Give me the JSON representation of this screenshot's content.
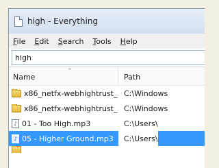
{
  "window": {
    "title": "high - Everything"
  },
  "menu": [
    {
      "label": "File",
      "accel": "F",
      "rest": "ile"
    },
    {
      "label": "Edit",
      "accel": "E",
      "rest": "dit"
    },
    {
      "label": "Search",
      "accel": "S",
      "rest": "earch"
    },
    {
      "label": "Tools",
      "accel": "T",
      "rest": "ools"
    },
    {
      "label": "Help",
      "accel": "H",
      "rest": "elp"
    }
  ],
  "search": {
    "value": "high"
  },
  "columns": {
    "name": "Name",
    "path": "Path"
  },
  "rows": [
    {
      "icon": "folder-icon",
      "name": "x86_netfx-webhightrust_...",
      "path": "C:\\Windows"
    },
    {
      "icon": "folder-icon",
      "name": "x86_netfx-webhightrust_...",
      "path": "C:\\Windows"
    },
    {
      "icon": "music-file-icon",
      "name": "01 - Too High.mp3",
      "path": "C:\\Users\\"
    },
    {
      "icon": "music-file-icon",
      "name": "05 - Higher Ground.mp3",
      "path": "C:\\Users\\"
    }
  ],
  "colors": {
    "selection": "#3399ff",
    "titlebar": "#d4e0ef",
    "background": "#f3efe2"
  }
}
